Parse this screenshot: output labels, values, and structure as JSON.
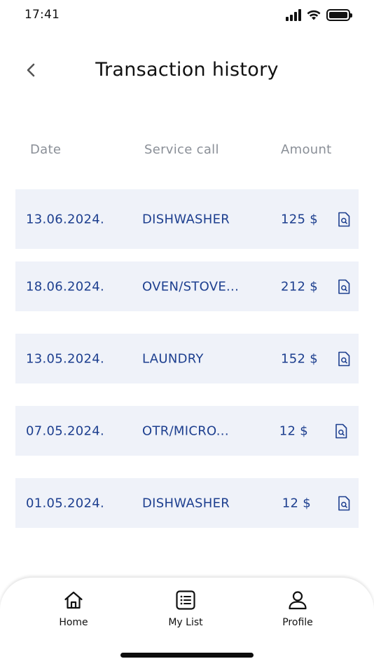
{
  "status_bar": {
    "time": "17:41"
  },
  "header": {
    "title": "Transaction history"
  },
  "columns": {
    "date": "Date",
    "service": "Service call",
    "amount": "Amount"
  },
  "transactions": [
    {
      "date": "13.06.2024.",
      "service": "DISHWASHER",
      "amount": "125 $"
    },
    {
      "date": "18.06.2024.",
      "service": "OVEN/STOVE...",
      "amount": "212 $"
    },
    {
      "date": "13.05.2024.",
      "service": "LAUNDRY",
      "amount": "152 $"
    },
    {
      "date": "07.05.2024.",
      "service": "OTR/MICRO...",
      "amount": "12 $"
    },
    {
      "date": "01.05.2024.",
      "service": "DISHWASHER",
      "amount": "12 $"
    }
  ],
  "bottom_nav": {
    "home": "Home",
    "my_list": "My List",
    "profile": "Profile"
  },
  "colors": {
    "accent": "#1d3f8f",
    "row_bg": "#eff2f9",
    "header_text": "#8a8f97"
  },
  "icons": {
    "back": "chevron-left-icon",
    "row_action": "document-search-icon",
    "home": "home-icon",
    "list": "list-icon",
    "profile": "user-icon"
  }
}
